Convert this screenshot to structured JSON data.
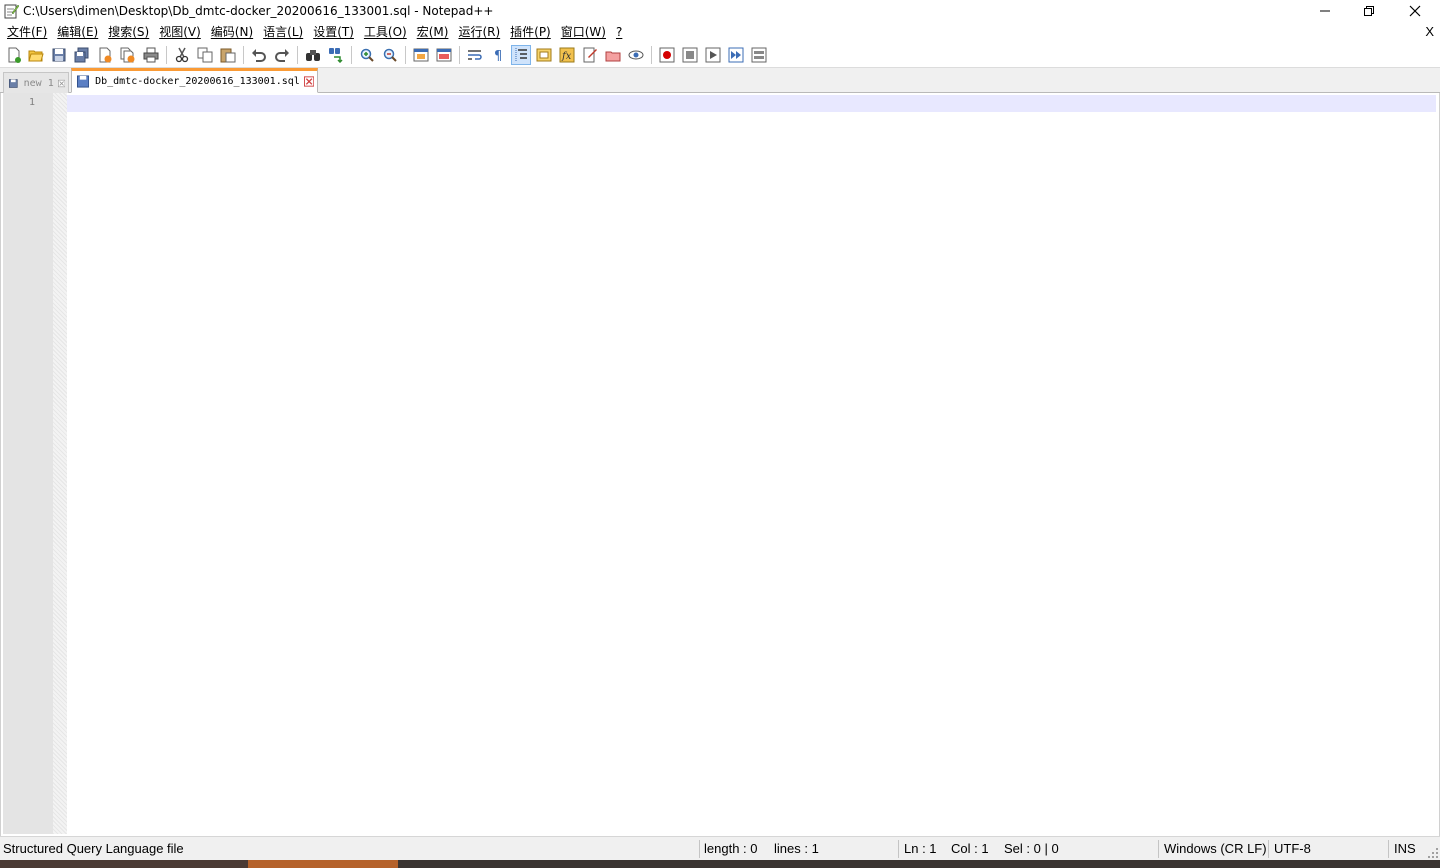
{
  "window": {
    "title": "C:\\Users\\dimen\\Desktop\\Db_dmtc-docker_20200616_133001.sql - Notepad++"
  },
  "menu": {
    "items": [
      "文件(F)",
      "编辑(E)",
      "搜索(S)",
      "视图(V)",
      "编码(N)",
      "语言(L)",
      "设置(T)",
      "工具(O)",
      "宏(M)",
      "运行(R)",
      "插件(P)",
      "窗口(W)",
      "?"
    ],
    "close_label": "X"
  },
  "toolbar": {
    "icons": [
      "new-file-icon",
      "open-file-icon",
      "save-icon",
      "save-all-icon",
      "close-icon",
      "close-all-icon",
      "print-icon",
      "cut-icon",
      "copy-icon",
      "paste-icon",
      "undo-icon",
      "redo-icon",
      "find-icon",
      "replace-icon",
      "zoom-in-icon",
      "zoom-out-icon",
      "sync-vertical-icon",
      "sync-horizontal-icon",
      "word-wrap-icon",
      "show-all-chars-icon",
      "indent-guide-icon",
      "doc-map-icon",
      "function-list-icon",
      "folder-workspace-icon",
      "document-list-icon",
      "monitoring-icon",
      "record-macro-icon",
      "stop-record-icon",
      "play-macro-icon",
      "run-macro-multiple-icon",
      "save-macro-icon"
    ],
    "active_icon": "indent-guide-icon"
  },
  "tabs": [
    {
      "label": "new 1",
      "active": false
    },
    {
      "label": "Db_dmtc-docker_20200616_133001.sql",
      "active": true
    }
  ],
  "editor": {
    "line_numbers": [
      "1"
    ],
    "content": "",
    "caret_line_color": "#e8e8ff"
  },
  "statusbar": {
    "file_type": "Structured Query Language file",
    "length": "length : 0",
    "lines": "lines : 1",
    "ln": "Ln : 1",
    "col": "Col : 1",
    "sel": "Sel : 0 | 0",
    "eol": "Windows (CR LF)",
    "encoding": "UTF-8",
    "mode": "INS"
  },
  "colors": {
    "active_tab_accent": "#fa9b36",
    "macro_record": "#d40000"
  }
}
